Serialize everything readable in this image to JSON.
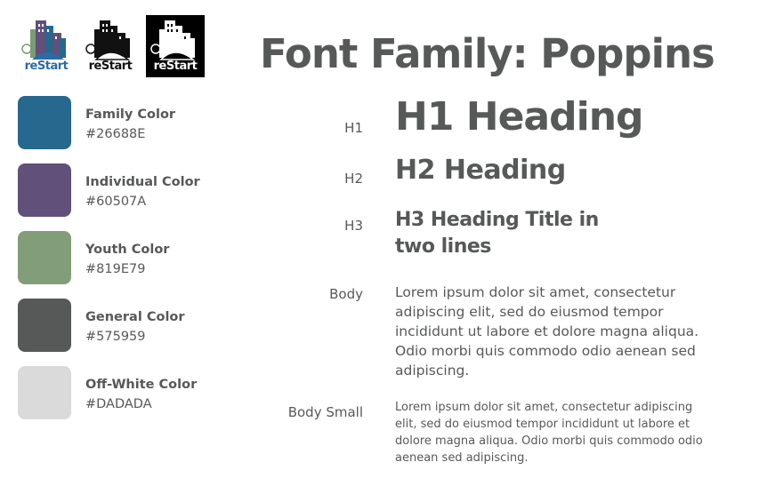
{
  "logos": [
    {
      "word": "reStart",
      "variant": "color"
    },
    {
      "word": "reStart",
      "variant": "black"
    },
    {
      "word": "reStart",
      "variant": "inverse"
    }
  ],
  "colors": [
    {
      "name": "Family Color",
      "hex": "#26688E"
    },
    {
      "name": "Individual Color",
      "hex": "#60507A"
    },
    {
      "name": "Youth Color",
      "hex": "#819E79"
    },
    {
      "name": "General Color",
      "hex": "#575959"
    },
    {
      "name": "Off-White Color",
      "hex": "#DADADA"
    }
  ],
  "typography": {
    "title": "Font Family: Poppins",
    "h1": {
      "label": "H1",
      "sample": "H1 Heading"
    },
    "h2": {
      "label": "H2",
      "sample": "H2 Heading"
    },
    "h3": {
      "label": "H3",
      "sample": "H3 Heading Title in two lines"
    },
    "body": {
      "label": "Body",
      "sample": "Lorem ipsum dolor sit amet, consectetur adipiscing elit, sed do eiusmod tempor incididunt ut labore et dolore magna aliqua. Odio morbi quis commodo odio aenean sed adipiscing."
    },
    "body_small": {
      "label": "Body Small",
      "sample": "Lorem ipsum dolor sit amet, consectetur adipiscing elit, sed do eiusmod tempor incididunt ut labore et dolore magna aliqua. Odio morbi quis commodo odio aenean sed adipiscing."
    }
  }
}
